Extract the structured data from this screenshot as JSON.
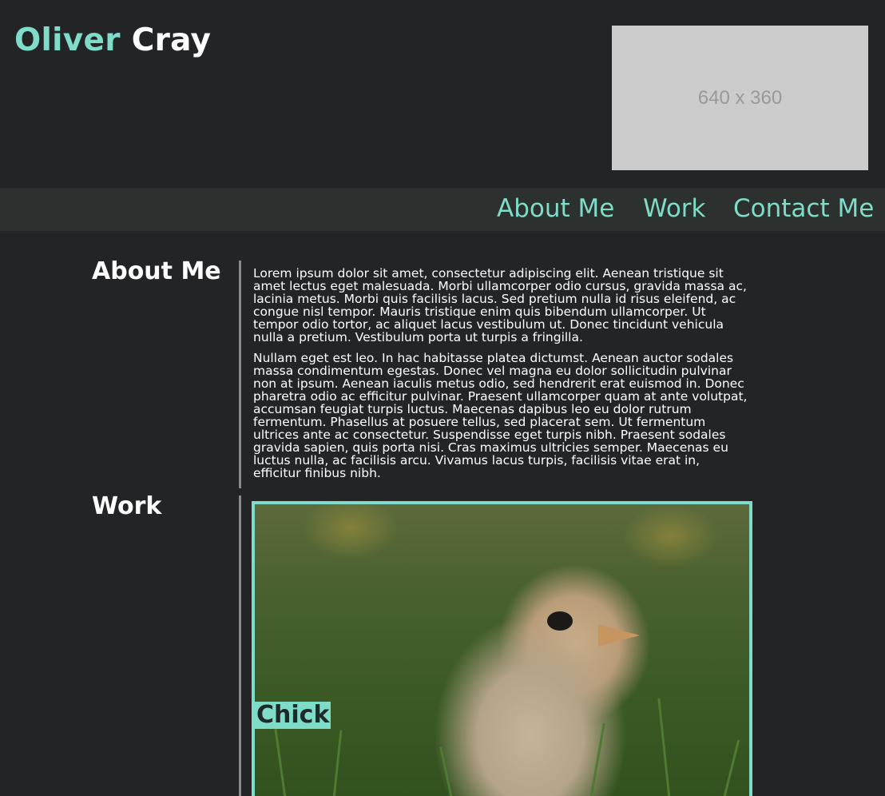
{
  "header": {
    "logo_first": "Oliver",
    "logo_last": "Cray",
    "placeholder_text": "640 x 360"
  },
  "nav": {
    "items": [
      {
        "label": "About Me"
      },
      {
        "label": "Work"
      },
      {
        "label": "Contact Me"
      }
    ]
  },
  "about": {
    "title": "About Me",
    "paragraphs": [
      "Lorem ipsum dolor sit amet, consectetur adipiscing elit. Aenean tristique sit amet lectus eget malesuada. Morbi ullamcorper odio cursus, gravida massa ac, lacinia metus. Morbi quis facilisis lacus. Sed pretium nulla id risus eleifend, ac congue nisl tempor. Mauris tristique enim quis bibendum ullamcorper. Ut tempor odio tortor, ac aliquet lacus vestibulum ut. Donec tincidunt vehicula nulla a pretium. Vestibulum porta ut turpis a fringilla.",
      "Nullam eget est leo. In hac habitasse platea dictumst. Aenean auctor sodales massa condimentum egestas. Donec vel magna eu dolor sollicitudin pulvinar non at ipsum. Aenean iaculis metus odio, sed hendrerit erat euismod in. Donec pharetra odio ac efficitur pulvinar. Praesent ullamcorper quam at ante volutpat, accumsan feugiat turpis luctus. Maecenas dapibus leo eu dolor rutrum fermentum. Phasellus at posuere tellus, sed placerat sem. Ut fermentum ultrices ante ac consectetur. Suspendisse eget turpis nibh. Praesent sodales gravida sapien, quis porta nisi. Cras maximus ultricies semper. Maecenas eu luctus nulla, ac facilisis arcu. Vivamus lacus turpis, facilisis vitae erat in, efficitur finibus nibh."
    ]
  },
  "work": {
    "title": "Work",
    "items": [
      {
        "caption": "Chick"
      }
    ]
  },
  "colors": {
    "accent": "#7fdcc8",
    "background": "#222426",
    "nav_background": "#2c302f",
    "divider": "#8a8a8a",
    "placeholder": "#cccccc"
  }
}
